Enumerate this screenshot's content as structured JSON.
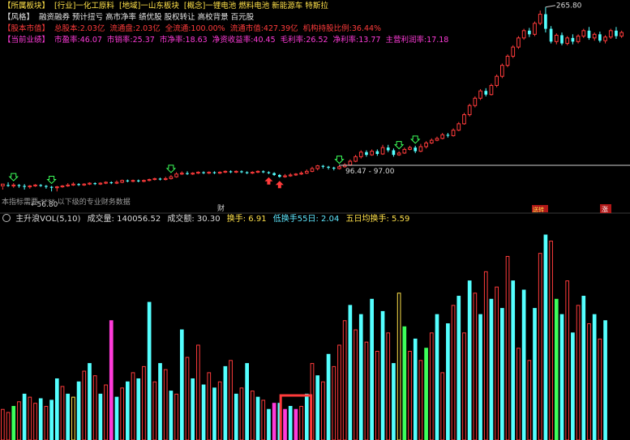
{
  "info": {
    "row1": [
      {
        "text": "【所属板块】",
        "color": "yellow"
      },
      {
        "text": "[行业]一化工原料",
        "color": "yellow"
      },
      {
        "text": "[地域]一山东板块",
        "color": "yellow"
      },
      {
        "text": "[概念]一锂电池 燃料电池 新能源车 特斯拉",
        "color": "yellow"
      }
    ],
    "row2": [
      {
        "text": "【风格】",
        "color": "white"
      },
      {
        "text": "融资融券 预计扭亏 高市净率 绩优股 股权转让 高校背景 百元股",
        "color": "white"
      }
    ],
    "row3": [
      {
        "text": "【股本市值】",
        "color": "red"
      },
      {
        "text": "总股本:2.03亿",
        "color": "red"
      },
      {
        "text": "流通盘:2.03亿",
        "color": "red"
      },
      {
        "text": "全流通:100.00%",
        "color": "red"
      },
      {
        "text": "流通市值:427.39亿",
        "color": "red"
      },
      {
        "text": "机构持股比例:36.44%",
        "color": "red"
      }
    ],
    "row4": [
      {
        "text": "【当前业绩】",
        "color": "magenta"
      },
      {
        "text": "市盈率:46.07",
        "color": "magenta"
      },
      {
        "text": "市销率:25.37",
        "color": "magenta"
      },
      {
        "text": "市净率:18.63",
        "color": "magenta"
      },
      {
        "text": "净资收益率:40.45",
        "color": "magenta"
      },
      {
        "text": "毛利率:26.52",
        "color": "magenta"
      },
      {
        "text": "净利率:13.77",
        "color": "magenta"
      },
      {
        "text": "主营利润率:17.18",
        "color": "magenta"
      }
    ]
  },
  "annotations": {
    "high_label": "265.80",
    "low_label": "56.80",
    "range_label": "96.47 - 97.00",
    "bottom_note": "本指标需要 ****  以下级的专业财务数据",
    "marker_cai": "财",
    "marker_gao": "送转",
    "marker_zhang": "涨"
  },
  "volume_header": {
    "title": "主升浪VOL(5,10)",
    "volume": "成交量: 140056.52",
    "amount": "成交额: 30.30",
    "turnover": "换手: 6.91",
    "low_turnover": "低换手55日: 2.04",
    "avg5_turnover": "五日均换手: 5.59"
  },
  "colors": {
    "up": "#ff3b3b",
    "down": "#54ffff",
    "signal_green": "#3cff5a",
    "signal_yellow": "#ffe14a",
    "signal_magenta": "#ff3bd9",
    "box": "#ff3b3b"
  },
  "chart_data": {
    "type": "candlestick",
    "price_range": [
      50,
      270
    ],
    "high_mark": 265.8,
    "low_mark": 56.8,
    "candles": [
      [
        70,
        72,
        69,
        66
      ],
      [
        71,
        70,
        74,
        69
      ],
      [
        70,
        71,
        73,
        68
      ],
      [
        71,
        70,
        72,
        68
      ],
      [
        70,
        69,
        72,
        66
      ],
      [
        69,
        70,
        71,
        67
      ],
      [
        70,
        71,
        72,
        69
      ],
      [
        71,
        70,
        72,
        69
      ],
      [
        70,
        69,
        71,
        67
      ],
      [
        69,
        68,
        70,
        64
      ],
      [
        68,
        69,
        70,
        64
      ],
      [
        69,
        70,
        71,
        68
      ],
      [
        70,
        71,
        73,
        69
      ],
      [
        71,
        72,
        74,
        70
      ],
      [
        72,
        71,
        73,
        70
      ],
      [
        71,
        72,
        73,
        70
      ],
      [
        72,
        73,
        74,
        71
      ],
      [
        73,
        72,
        74,
        71
      ],
      [
        72,
        73,
        74,
        71
      ],
      [
        73,
        74,
        75,
        72
      ],
      [
        74,
        73,
        75,
        72
      ],
      [
        73,
        74,
        76,
        72
      ],
      [
        74,
        76,
        77,
        73
      ],
      [
        76,
        75,
        77,
        74
      ],
      [
        75,
        76,
        77,
        74
      ],
      [
        76,
        75,
        77,
        74
      ],
      [
        75,
        76,
        77,
        74
      ],
      [
        76,
        77,
        78,
        75
      ],
      [
        77,
        78,
        79,
        76
      ],
      [
        78,
        77,
        79,
        76
      ],
      [
        77,
        78,
        80,
        76
      ],
      [
        78,
        80,
        82,
        77
      ],
      [
        80,
        83,
        85,
        79
      ],
      [
        83,
        84,
        86,
        82
      ],
      [
        84,
        83,
        86,
        82
      ],
      [
        83,
        84,
        85,
        82
      ],
      [
        84,
        85,
        86,
        83
      ],
      [
        85,
        84,
        86,
        83
      ],
      [
        84,
        85,
        86,
        83
      ],
      [
        85,
        84,
        86,
        83
      ],
      [
        84,
        85,
        86,
        83
      ],
      [
        85,
        86,
        87,
        84
      ],
      [
        86,
        85,
        87,
        84
      ],
      [
        85,
        86,
        87,
        84
      ],
      [
        86,
        85,
        87,
        84
      ],
      [
        85,
        84,
        86,
        83
      ],
      [
        84,
        85,
        86,
        83
      ],
      [
        85,
        86,
        87,
        84
      ],
      [
        86,
        85,
        87,
        84
      ],
      [
        85,
        84,
        86,
        83
      ],
      [
        84,
        82,
        85,
        81
      ],
      [
        82,
        80,
        83,
        79
      ],
      [
        80,
        81,
        83,
        79
      ],
      [
        81,
        82,
        84,
        80
      ],
      [
        82,
        83,
        84,
        81
      ],
      [
        83,
        84,
        86,
        82
      ],
      [
        84,
        86,
        88,
        83
      ],
      [
        86,
        89,
        91,
        85
      ],
      [
        89,
        92,
        93,
        87
      ],
      [
        92,
        91,
        93,
        89
      ],
      [
        91,
        90,
        92,
        88
      ],
      [
        90,
        89,
        91,
        87
      ],
      [
        89,
        91,
        92,
        88
      ],
      [
        91,
        93,
        95,
        90
      ],
      [
        93,
        97,
        99,
        92
      ],
      [
        97,
        102,
        104,
        96
      ],
      [
        102,
        107,
        109,
        100
      ],
      [
        107,
        104,
        109,
        102
      ],
      [
        104,
        108,
        110,
        103
      ],
      [
        108,
        105,
        110,
        103
      ],
      [
        105,
        112,
        115,
        104
      ],
      [
        112,
        109,
        115,
        107
      ],
      [
        109,
        104,
        111,
        102
      ],
      [
        104,
        106,
        108,
        103
      ],
      [
        106,
        110,
        112,
        105
      ],
      [
        110,
        112,
        114,
        109
      ],
      [
        112,
        108,
        114,
        106
      ],
      [
        108,
        113,
        116,
        107
      ],
      [
        113,
        117,
        119,
        111
      ],
      [
        117,
        120,
        122,
        116
      ],
      [
        120,
        122,
        124,
        119
      ],
      [
        122,
        126,
        128,
        121
      ],
      [
        126,
        125,
        128,
        123
      ],
      [
        125,
        131,
        133,
        124
      ],
      [
        131,
        138,
        140,
        130
      ],
      [
        138,
        148,
        150,
        137
      ],
      [
        148,
        158,
        160,
        146
      ],
      [
        158,
        166,
        168,
        156
      ],
      [
        166,
        174,
        176,
        164
      ],
      [
        174,
        170,
        177,
        168
      ],
      [
        170,
        180,
        182,
        169
      ],
      [
        180,
        190,
        192,
        178
      ],
      [
        190,
        202,
        204,
        188
      ],
      [
        202,
        212,
        214,
        200
      ],
      [
        212,
        222,
        224,
        210
      ],
      [
        222,
        232,
        234,
        220
      ],
      [
        232,
        240,
        242,
        230
      ],
      [
        240,
        236,
        243,
        233
      ],
      [
        236,
        248,
        250,
        234
      ],
      [
        248,
        258,
        262,
        246
      ],
      [
        258,
        242,
        265.8,
        238
      ],
      [
        242,
        228,
        245,
        226
      ],
      [
        228,
        235,
        237,
        225
      ],
      [
        235,
        226,
        238,
        224
      ],
      [
        226,
        232,
        234,
        224
      ],
      [
        232,
        228,
        236,
        225
      ],
      [
        228,
        234,
        236,
        226
      ],
      [
        234,
        240,
        242,
        232
      ],
      [
        240,
        232,
        244,
        230
      ],
      [
        232,
        236,
        238,
        229
      ],
      [
        236,
        229,
        239,
        227
      ],
      [
        229,
        233,
        235,
        226
      ],
      [
        233,
        240,
        242,
        231
      ],
      [
        240,
        234,
        244,
        231
      ],
      [
        234,
        238,
        240,
        232
      ]
    ],
    "volumes": [
      [
        20,
        1
      ],
      [
        18,
        1
      ],
      [
        22,
        2
      ],
      [
        25,
        1
      ],
      [
        30,
        0
      ],
      [
        28,
        1
      ],
      [
        24,
        1
      ],
      [
        27,
        0
      ],
      [
        22,
        1
      ],
      [
        26,
        0
      ],
      [
        40,
        0
      ],
      [
        35,
        1
      ],
      [
        30,
        0
      ],
      [
        28,
        1
      ],
      [
        38,
        0
      ],
      [
        45,
        1
      ],
      [
        50,
        0
      ],
      [
        42,
        1
      ],
      [
        30,
        0
      ],
      [
        36,
        1
      ],
      [
        78,
        3
      ],
      [
        28,
        0
      ],
      [
        34,
        1
      ],
      [
        38,
        0
      ],
      [
        44,
        1
      ],
      [
        40,
        0
      ],
      [
        48,
        1
      ],
      [
        90,
        0
      ],
      [
        38,
        1
      ],
      [
        50,
        0
      ],
      [
        46,
        1
      ],
      [
        32,
        0
      ],
      [
        30,
        1
      ],
      [
        72,
        0
      ],
      [
        54,
        1
      ],
      [
        40,
        0
      ],
      [
        62,
        1
      ],
      [
        36,
        0
      ],
      [
        44,
        1
      ],
      [
        34,
        0
      ],
      [
        38,
        1
      ],
      [
        48,
        0
      ],
      [
        52,
        1
      ],
      [
        30,
        0
      ],
      [
        34,
        1
      ],
      [
        50,
        0
      ],
      [
        32,
        1
      ],
      [
        28,
        0
      ],
      [
        26,
        1
      ],
      [
        20,
        0
      ],
      [
        24,
        3
      ],
      [
        24,
        0
      ],
      [
        20,
        3
      ],
      [
        22,
        0
      ],
      [
        20,
        3
      ],
      [
        22,
        1
      ],
      [
        30,
        0
      ],
      [
        50,
        1
      ],
      [
        42,
        0
      ],
      [
        38,
        1
      ],
      [
        56,
        0
      ],
      [
        48,
        1
      ],
      [
        62,
        1
      ],
      [
        78,
        1
      ],
      [
        88,
        0
      ],
      [
        72,
        1
      ],
      [
        82,
        0
      ],
      [
        64,
        1
      ],
      [
        92,
        0
      ],
      [
        58,
        1
      ],
      [
        84,
        0
      ],
      [
        70,
        1
      ],
      [
        50,
        0
      ],
      [
        96,
        1
      ],
      [
        74,
        2
      ],
      [
        58,
        1
      ],
      [
        66,
        0
      ],
      [
        52,
        1
      ],
      [
        60,
        2
      ],
      [
        70,
        1
      ],
      [
        82,
        0
      ],
      [
        44,
        1
      ],
      [
        76,
        0
      ],
      [
        88,
        1
      ],
      [
        94,
        0
      ],
      [
        70,
        1
      ],
      [
        104,
        0
      ],
      [
        96,
        1
      ],
      [
        82,
        0
      ],
      [
        110,
        1
      ],
      [
        92,
        0
      ],
      [
        100,
        1
      ],
      [
        86,
        0
      ],
      [
        120,
        1
      ],
      [
        104,
        0
      ],
      [
        60,
        1
      ],
      [
        98,
        0
      ],
      [
        52,
        1
      ],
      [
        86,
        0
      ],
      [
        122,
        1
      ],
      [
        134,
        0
      ],
      [
        130,
        1
      ],
      [
        92,
        2
      ],
      [
        82,
        0
      ],
      [
        104,
        1
      ],
      [
        70,
        0
      ],
      [
        88,
        1
      ],
      [
        94,
        0
      ],
      [
        76,
        1
      ],
      [
        82,
        0
      ],
      [
        66,
        1
      ],
      [
        78,
        0
      ]
    ],
    "annotated_box_range": [
      52,
      56
    ]
  }
}
